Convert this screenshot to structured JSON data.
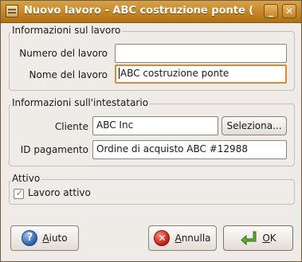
{
  "window": {
    "title": "Nuovo lavoro - ABC costruzione ponte (",
    "minimize_label": "_",
    "close_label": "✕"
  },
  "job_info": {
    "legend": "Informazioni sul lavoro",
    "number_label": "Numero del lavoro",
    "number_value": "",
    "name_label": "Nome del lavoro",
    "name_value": "ABC costruzione ponte"
  },
  "owner_info": {
    "legend": "Informazioni sull'intestatario",
    "customer_label": "Cliente",
    "customer_value": "ABC Inc",
    "select_button": "Seleziona...",
    "payment_id_label": "ID pagamento",
    "payment_id_value": "Ordine di acquisto ABC #12988"
  },
  "active": {
    "legend": "Attivo",
    "checkbox_label": "Lavoro attivo",
    "checked": true
  },
  "buttons": {
    "help_mnemonic": "A",
    "help_rest": "iuto",
    "cancel_mnemonic": "A",
    "cancel_rest": "nnulla",
    "ok_mnemonic": "O",
    "ok_rest": "K",
    "help_glyph": "?",
    "cancel_glyph": "✕",
    "checkmark_glyph": "✓"
  },
  "colors": {
    "titlebar": "#c88b2c",
    "focus": "#d8893c",
    "ok_arrow": "#4c9a2a"
  }
}
